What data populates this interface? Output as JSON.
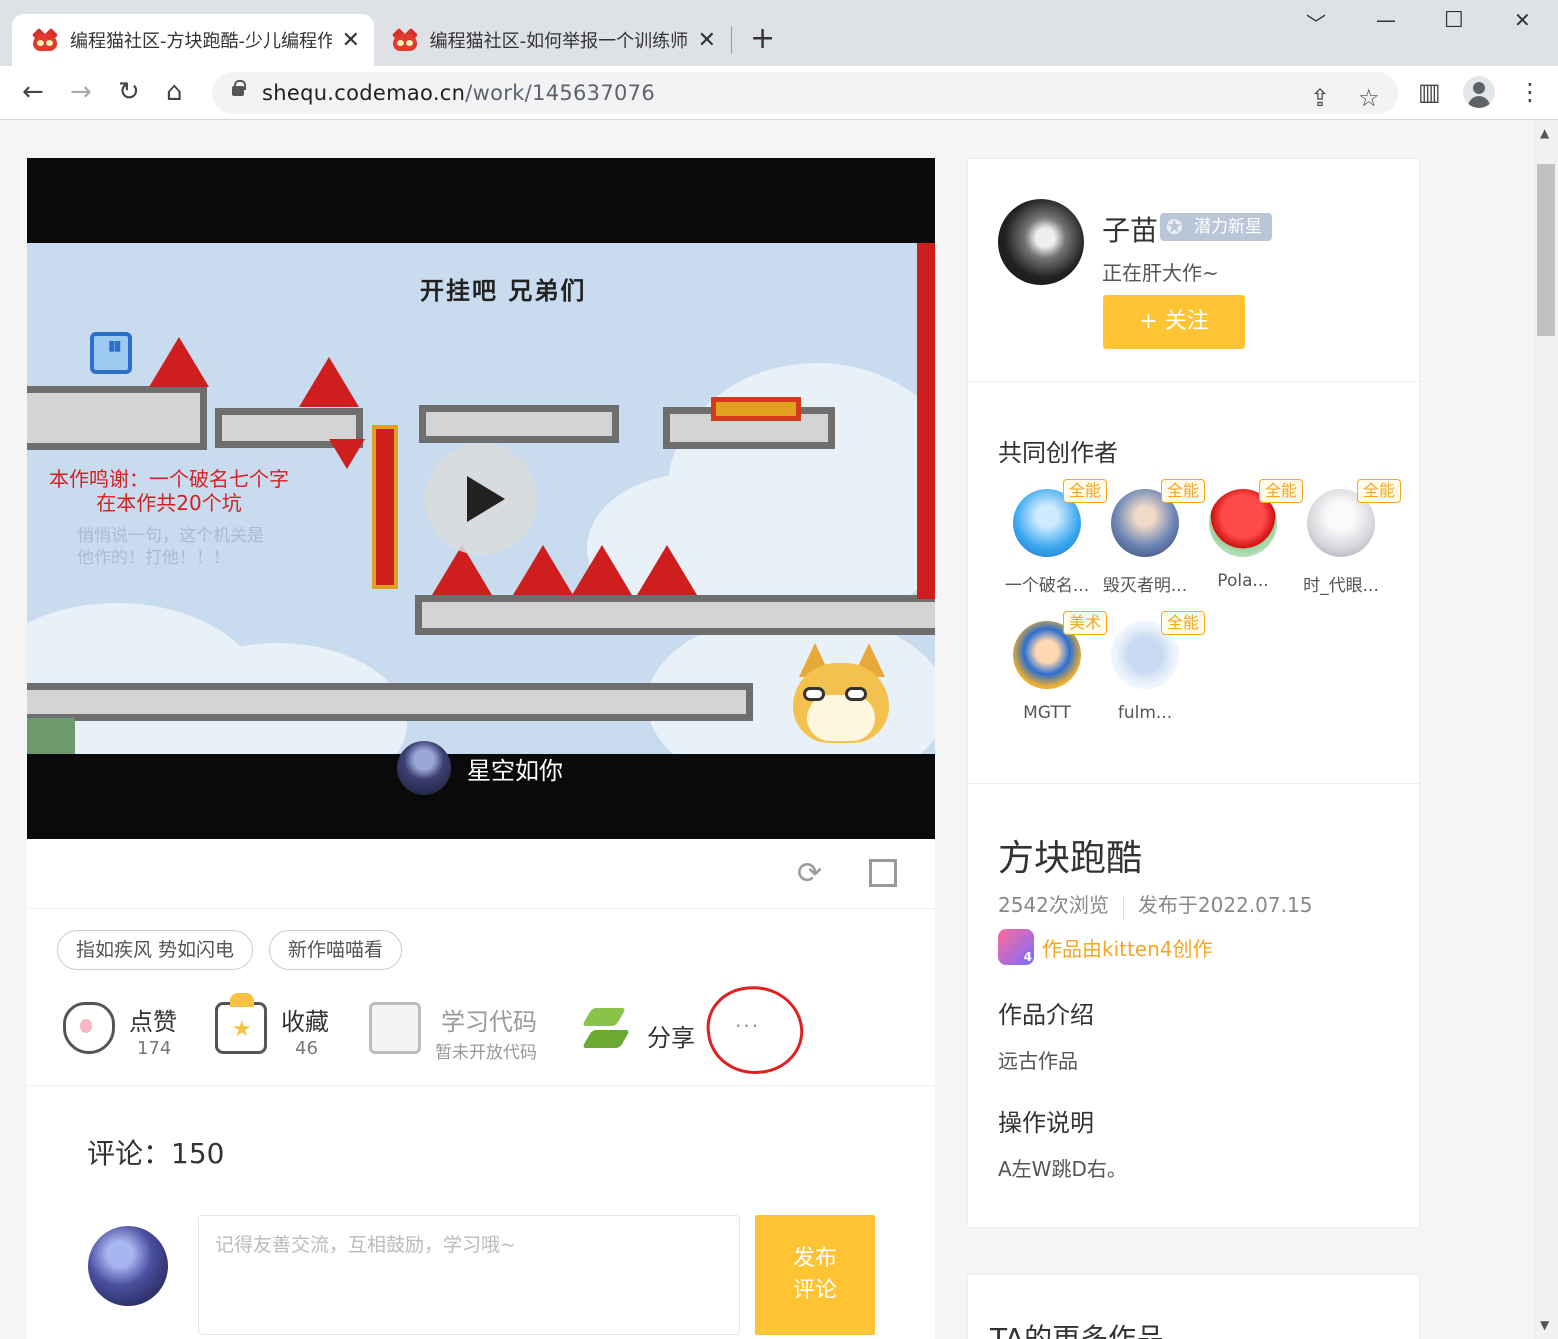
{
  "browser": {
    "tabs": [
      {
        "title": "编程猫社区-方块跑酷-少儿编程作品",
        "active": true
      },
      {
        "title": "编程猫社区-如何举报一个训练师",
        "active": false
      }
    ],
    "new_tab": "+",
    "url_host": "shequ.codemao.cn",
    "url_path": "/work/145637076",
    "window_controls": {
      "dropdown": "﹀",
      "minimize": "—",
      "maximize": "☐",
      "close": "✕"
    },
    "icons": {
      "back": "←",
      "forward": "→",
      "reload": "↻",
      "home": "⌂",
      "share": "⇪",
      "bookmark": "☆",
      "sidebar": "▥",
      "menu": "⋮"
    }
  },
  "player": {
    "stage_title": "开挂吧 兄弟们",
    "credit_line1": "本作鸣谢：一个破名七个字",
    "credit_line2": "在本作共20个坑",
    "faint_line1": "悄悄说一句，这个机关是",
    "faint_line2": "他作的！打他！！！",
    "uploader_name": "星空如你"
  },
  "controls": {
    "restart_icon": "⟳"
  },
  "tags": [
    "指如疾风 势如闪电",
    "新作喵喵看"
  ],
  "actions": {
    "like_label": "点赞",
    "like_count": "174",
    "collect_label": "收藏",
    "collect_count": "46",
    "code_label": "学习代码",
    "code_sub": "暂未开放代码",
    "share_label": "分享",
    "more": "···"
  },
  "comments": {
    "title": "评论：150",
    "placeholder": "记得友善交流，互相鼓励，学习哦~",
    "submit_line1": "发布",
    "submit_line2": "评论"
  },
  "author": {
    "name": "子苗",
    "badge": "潜力新星",
    "signature": "正在肝大作~",
    "follow_label": "+ 关注"
  },
  "co_creators": {
    "title": "共同创作者",
    "items": [
      {
        "name": "一个破名...",
        "role": "全能"
      },
      {
        "name": "毁灭者明...",
        "role": "全能"
      },
      {
        "name": "Pola...",
        "role": "全能"
      },
      {
        "name": "时_代眼...",
        "role": "全能"
      },
      {
        "name": "MGTT",
        "role": "美术"
      },
      {
        "name": "fulm...",
        "role": "全能"
      }
    ]
  },
  "work": {
    "title": "方块跑酷",
    "views": "2542次浏览",
    "published": "发布于2022.07.15",
    "made_with": "作品由kitten4创作",
    "intro_title": "作品介绍",
    "intro_text": "远古作品",
    "howto_title": "操作说明",
    "howto_text": "A左W跳D右。"
  },
  "more_works_title": "TA的更多作品"
}
